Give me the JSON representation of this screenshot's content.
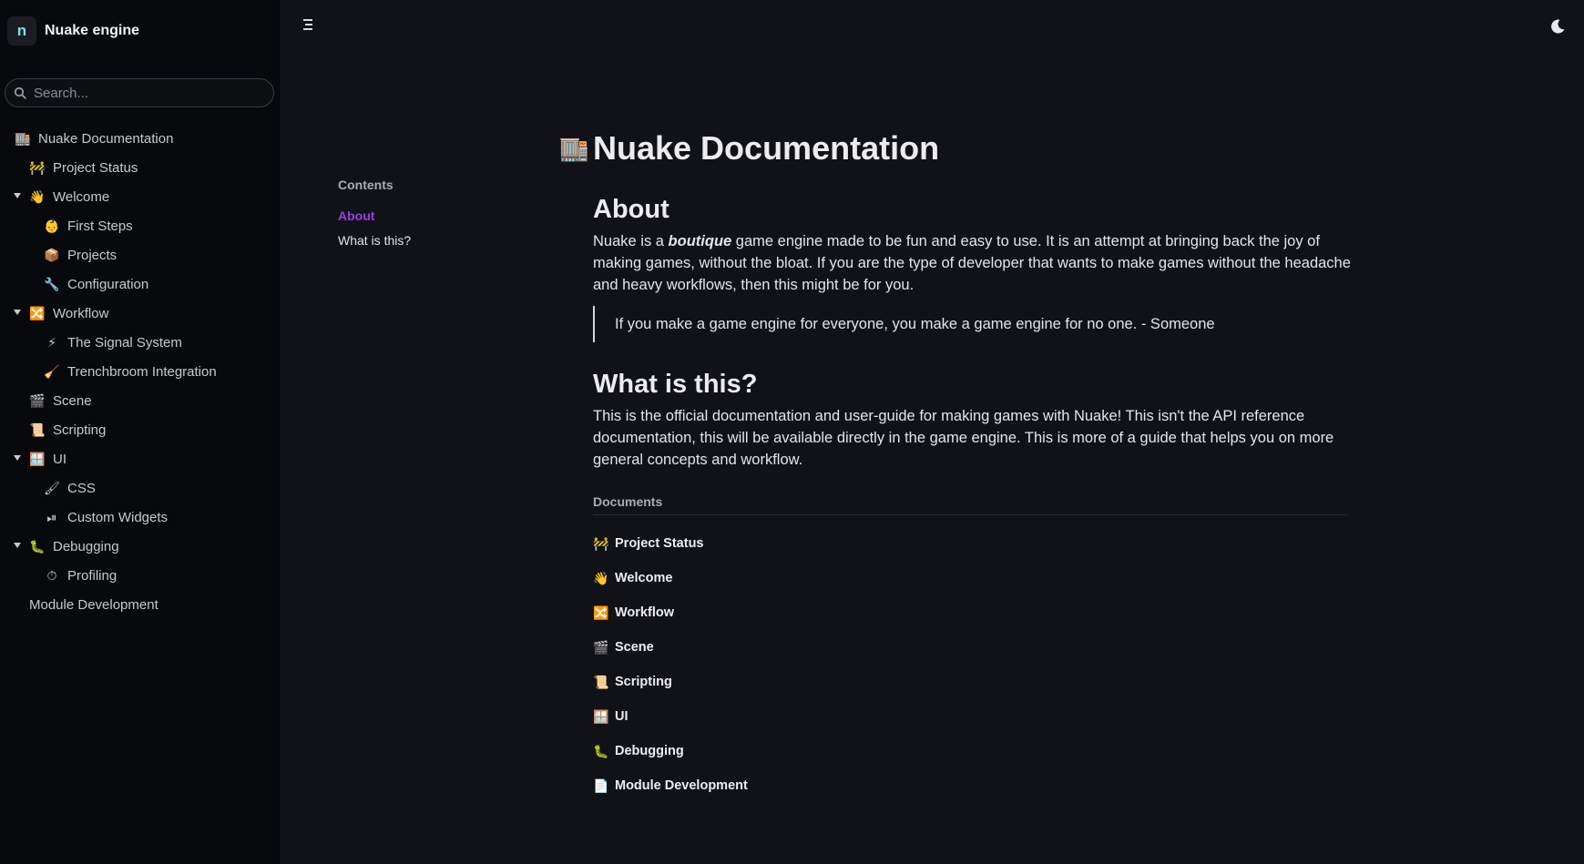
{
  "brand": {
    "name": "Nuake engine",
    "logo_glyph": "n"
  },
  "search": {
    "placeholder": "Search..."
  },
  "sidebar": {
    "items": [
      {
        "label": "Nuake Documentation",
        "icon": "building-icon",
        "emoji": "🏬",
        "level": 0,
        "expandable": false
      },
      {
        "label": "Project Status",
        "icon": "construction-icon",
        "emoji": "🚧",
        "level": 1,
        "expandable": false
      },
      {
        "label": "Welcome",
        "icon": "wave-icon",
        "emoji": "👋",
        "level": 1,
        "expandable": true
      },
      {
        "label": "First Steps",
        "icon": "baby-icon",
        "emoji": "👶",
        "level": 2,
        "expandable": false
      },
      {
        "label": "Projects",
        "icon": "package-icon",
        "emoji": "📦",
        "level": 2,
        "expandable": false
      },
      {
        "label": "Configuration",
        "icon": "wrench-icon",
        "emoji": "🔧",
        "level": 2,
        "expandable": false
      },
      {
        "label": "Workflow",
        "icon": "shuffle-icon",
        "emoji": "🔀",
        "level": 1,
        "expandable": true
      },
      {
        "label": "The Signal System",
        "icon": "lightning-icon",
        "emoji": "⚡",
        "level": 2,
        "expandable": false
      },
      {
        "label": "Trenchbroom Integration",
        "icon": "broom-icon",
        "emoji": "🧹",
        "level": 2,
        "expandable": false
      },
      {
        "label": "Scene",
        "icon": "clapper-icon",
        "emoji": "🎬",
        "level": 1,
        "expandable": false
      },
      {
        "label": "Scripting",
        "icon": "scroll-icon",
        "emoji": "📜",
        "level": 1,
        "expandable": false
      },
      {
        "label": "UI",
        "icon": "window-icon",
        "emoji": "🪟",
        "level": 1,
        "expandable": true
      },
      {
        "label": "CSS",
        "icon": "paintbrush-icon",
        "emoji": "🖌",
        "level": 2,
        "expandable": false
      },
      {
        "label": "Custom Widgets",
        "icon": "play-pause-icon",
        "emoji": "⏯",
        "level": 2,
        "expandable": false
      },
      {
        "label": "Debugging",
        "icon": "worm-icon",
        "emoji": "🐛",
        "level": 1,
        "expandable": true
      },
      {
        "label": "Profiling",
        "icon": "stopwatch-icon",
        "emoji": "⏱",
        "level": 2,
        "expandable": false
      },
      {
        "label": "Module Development",
        "icon": "",
        "emoji": "",
        "level": 1,
        "expandable": false
      }
    ]
  },
  "toc": {
    "title": "Contents",
    "links": [
      {
        "label": "About",
        "active": true
      },
      {
        "label": "What is this?",
        "active": false
      }
    ]
  },
  "page": {
    "title": "Nuake Documentation",
    "title_emoji": "🏬",
    "about_heading": "About",
    "about_prefix": "Nuake is a ",
    "about_emphasis": "boutique",
    "about_suffix": " game engine made to be fun and easy to use. It is an attempt at bringing back the joy of making games, without the bloat. If you are the type of developer that wants to make games without the headache and heavy workflows, then this might be for you.",
    "quote": "If you make a game engine for everyone, you make a game engine for no one. - Someone",
    "what_heading": "What is this?",
    "what_body": "This is the official documentation and user-guide for making games with Nuake! This isn't the API reference documentation, this will be available directly in the game engine. This is more of a guide that helps you on more general concepts and workflow.",
    "documents_label": "Documents",
    "documents": [
      {
        "label": "Project Status",
        "emoji": "🚧"
      },
      {
        "label": "Welcome",
        "emoji": "👋"
      },
      {
        "label": "Workflow",
        "emoji": "🔀"
      },
      {
        "label": "Scene",
        "emoji": "🎬"
      },
      {
        "label": "Scripting",
        "emoji": "📜"
      },
      {
        "label": "UI",
        "emoji": "🪟"
      },
      {
        "label": "Debugging",
        "emoji": "🐛"
      },
      {
        "label": "Module Development",
        "emoji": "📄"
      }
    ]
  },
  "colors": {
    "accent": "#9a3fe0",
    "background": "#111217",
    "sidebar": "#08090c"
  }
}
